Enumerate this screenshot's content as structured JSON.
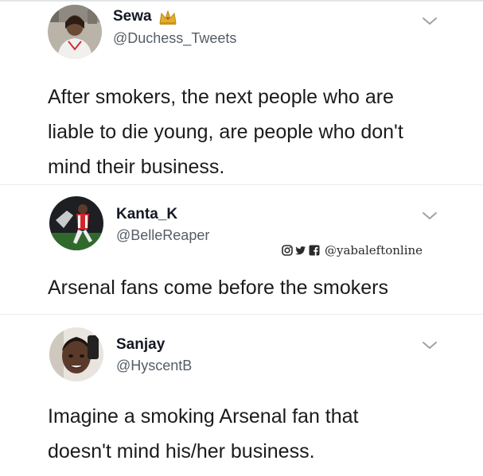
{
  "tweets": [
    {
      "display_name": "Sewa",
      "name_emoji": "crown-emoji",
      "handle": "@Duchess_Tweets",
      "text": "After smokers, the next people who are\nliable to die young, are people who don't\nmind their business.",
      "menu_icon": "chevron-down-icon"
    },
    {
      "display_name": "Kanta_K",
      "handle": "@BelleReaper",
      "text": "Arsenal fans come before the smokers",
      "menu_icon": "chevron-down-icon"
    },
    {
      "display_name": "Sanjay",
      "handle": "@HyscentB",
      "text": "Imagine a smoking Arsenal fan that\ndoesn't mind his/her business.",
      "menu_icon": "chevron-down-icon"
    }
  ],
  "watermark": {
    "icons": [
      "instagram-icon",
      "twitter-icon",
      "facebook-icon"
    ],
    "text": "@yabaleftonline"
  },
  "colors": {
    "name": "#141823",
    "handle": "#555d66",
    "body_text": "#1b1b1b",
    "divider": "#e6ecf0",
    "chevron": "#9aa3ab",
    "crown": "#e0b027"
  }
}
